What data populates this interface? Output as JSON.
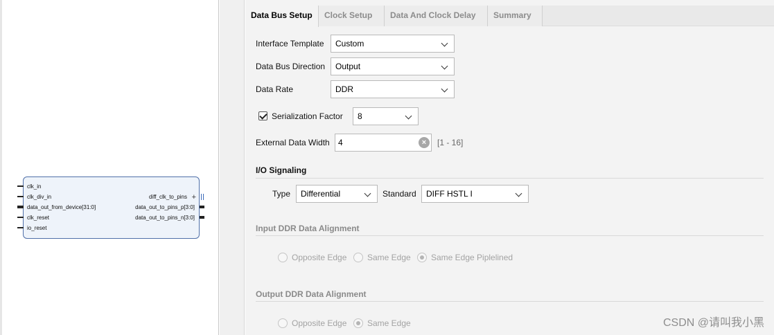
{
  "diagram": {
    "inputs": [
      "clk_in",
      "clk_div_in",
      "data_out_from_device[31:0]",
      "clk_reset",
      "io_reset"
    ],
    "outputs": [
      "diff_clk_to_pins",
      "data_out_to_pins_p[3:0]",
      "data_out_to_pins_n[3:0]"
    ]
  },
  "tabs": [
    {
      "label": "Data Bus Setup",
      "active": true
    },
    {
      "label": "Clock Setup",
      "active": false
    },
    {
      "label": "Data And Clock Delay",
      "active": false
    },
    {
      "label": "Summary",
      "active": false
    }
  ],
  "form": {
    "interface_template": {
      "label": "Interface Template",
      "value": "Custom"
    },
    "data_bus_direction": {
      "label": "Data Bus Direction",
      "value": "Output"
    },
    "data_rate": {
      "label": "Data Rate",
      "value": "DDR"
    },
    "serialization_factor": {
      "label": "Serialization Factor",
      "value": "8",
      "checked": true
    },
    "external_data_width": {
      "label": "External Data Width",
      "value": "4",
      "range": "[1 - 16]"
    }
  },
  "io_signaling": {
    "title": "I/O Signaling",
    "type_label": "Type",
    "type_value": "Differential",
    "standard_label": "Standard",
    "standard_value": "DIFF HSTL I"
  },
  "input_ddr": {
    "title": "Input DDR Data Alignment",
    "options": [
      "Opposite Edge",
      "Same Edge",
      "Same Edge Piplelined"
    ],
    "selected": 2
  },
  "output_ddr": {
    "title": "Output DDR Data Alignment",
    "options": [
      "Opposite Edge",
      "Same Edge"
    ],
    "selected": 1
  },
  "watermark": "CSDN @请叫我小黑"
}
